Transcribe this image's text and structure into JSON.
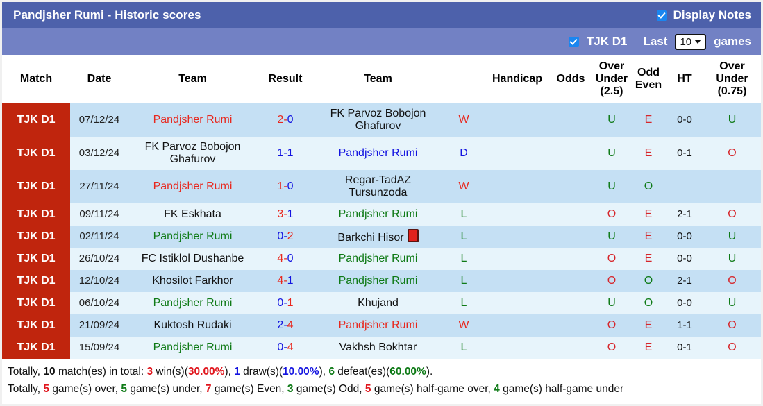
{
  "header": {
    "title": "Pandjsher Rumi - Historic scores",
    "display_notes_label": "Display Notes",
    "display_notes_checked": true,
    "league_label": "TJK D1",
    "league_checked": true,
    "last_label": "Last",
    "games_count": "10",
    "games_label": "games",
    "bar_color": "#4d61ab",
    "filter_bar_color": "#7281c4"
  },
  "table": {
    "columns": [
      "Match",
      "Date",
      "Team",
      "Result",
      "Team",
      "Handicap",
      "Odds",
      "Over Under (2.5)",
      "Odd Even",
      "HT",
      "Over Under (0.75)"
    ],
    "headers": {
      "match": "Match",
      "date": "Date",
      "team_home": "Team",
      "result": "Result",
      "team_away": "Team",
      "wdl": "",
      "handicap": "Handicap",
      "odds": "Odds",
      "ou25_l1": "Over",
      "ou25_l2": "Under",
      "ou25_l3": "(2.5)",
      "oe_l1": "Odd",
      "oe_l2": "Even",
      "ht": "HT",
      "ou075_l1": "Over",
      "ou075_l2": "Under",
      "ou075_l3": "(0.75)"
    },
    "rows": [
      {
        "match": "TJK D1",
        "date": "07/12/24",
        "home": "Pandjsher Rumi",
        "home_color": "red",
        "score_home": "2",
        "score_away": "0",
        "score_home_color": "red",
        "score_away_color": "blue",
        "away": "FK Parvoz Bobojon Ghafurov",
        "away_color": "black",
        "away_redcard": false,
        "wdl": "W",
        "wdl_color": "red",
        "handicap": "",
        "odds": "",
        "ou25": "U",
        "ou25_color": "green",
        "oe": "E",
        "oe_color": "red",
        "ht": "0-0",
        "ou075": "U",
        "ou075_color": "green",
        "tall": true
      },
      {
        "match": "TJK D1",
        "date": "03/12/24",
        "home": "FK Parvoz Bobojon Ghafurov",
        "home_color": "black",
        "score_home": "1",
        "score_away": "1",
        "score_home_color": "blue",
        "score_away_color": "blue",
        "away": "Pandjsher Rumi",
        "away_color": "blue",
        "away_redcard": false,
        "wdl": "D",
        "wdl_color": "blue",
        "handicap": "",
        "odds": "",
        "ou25": "U",
        "ou25_color": "green",
        "oe": "E",
        "oe_color": "red",
        "ht": "0-1",
        "ou075": "O",
        "ou075_color": "red",
        "tall": true
      },
      {
        "match": "TJK D1",
        "date": "27/11/24",
        "home": "Pandjsher Rumi",
        "home_color": "red",
        "score_home": "1",
        "score_away": "0",
        "score_home_color": "red",
        "score_away_color": "blue",
        "away": "Regar-TadAZ Tursunzoda",
        "away_color": "black",
        "away_redcard": false,
        "wdl": "W",
        "wdl_color": "red",
        "handicap": "",
        "odds": "",
        "ou25": "U",
        "ou25_color": "green",
        "oe": "O",
        "oe_color": "green",
        "ht": "",
        "ou075": "",
        "ou075_color": "green",
        "tall": true
      },
      {
        "match": "TJK D1",
        "date": "09/11/24",
        "home": "FK Eskhata",
        "home_color": "black",
        "score_home": "3",
        "score_away": "1",
        "score_home_color": "red",
        "score_away_color": "blue",
        "away": "Pandjsher Rumi",
        "away_color": "green",
        "away_redcard": false,
        "wdl": "L",
        "wdl_color": "green",
        "handicap": "",
        "odds": "",
        "ou25": "O",
        "ou25_color": "red",
        "oe": "E",
        "oe_color": "red",
        "ht": "2-1",
        "ou075": "O",
        "ou075_color": "red",
        "tall": false
      },
      {
        "match": "TJK D1",
        "date": "02/11/24",
        "home": "Pandjsher Rumi",
        "home_color": "green",
        "score_home": "0",
        "score_away": "2",
        "score_home_color": "blue",
        "score_away_color": "red",
        "away": "Barkchi Hisor",
        "away_color": "black",
        "away_redcard": true,
        "wdl": "L",
        "wdl_color": "green",
        "handicap": "",
        "odds": "",
        "ou25": "U",
        "ou25_color": "green",
        "oe": "E",
        "oe_color": "red",
        "ht": "0-0",
        "ou075": "U",
        "ou075_color": "green",
        "tall": false
      },
      {
        "match": "TJK D1",
        "date": "26/10/24",
        "home": "FC Istiklol Dushanbe",
        "home_color": "black",
        "score_home": "4",
        "score_away": "0",
        "score_home_color": "red",
        "score_away_color": "blue",
        "away": "Pandjsher Rumi",
        "away_color": "green",
        "away_redcard": false,
        "wdl": "L",
        "wdl_color": "green",
        "handicap": "",
        "odds": "",
        "ou25": "O",
        "ou25_color": "red",
        "oe": "E",
        "oe_color": "red",
        "ht": "0-0",
        "ou075": "U",
        "ou075_color": "green",
        "tall": false
      },
      {
        "match": "TJK D1",
        "date": "12/10/24",
        "home": "Khosilot Farkhor",
        "home_color": "black",
        "score_home": "4",
        "score_away": "1",
        "score_home_color": "red",
        "score_away_color": "blue",
        "away": "Pandjsher Rumi",
        "away_color": "green",
        "away_redcard": false,
        "wdl": "L",
        "wdl_color": "green",
        "handicap": "",
        "odds": "",
        "ou25": "O",
        "ou25_color": "red",
        "oe": "O",
        "oe_color": "green",
        "ht": "2-1",
        "ou075": "O",
        "ou075_color": "red",
        "tall": false
      },
      {
        "match": "TJK D1",
        "date": "06/10/24",
        "home": "Pandjsher Rumi",
        "home_color": "green",
        "score_home": "0",
        "score_away": "1",
        "score_home_color": "blue",
        "score_away_color": "red",
        "away": "Khujand",
        "away_color": "black",
        "away_redcard": false,
        "wdl": "L",
        "wdl_color": "green",
        "handicap": "",
        "odds": "",
        "ou25": "U",
        "ou25_color": "green",
        "oe": "O",
        "oe_color": "green",
        "ht": "0-0",
        "ou075": "U",
        "ou075_color": "green",
        "tall": false
      },
      {
        "match": "TJK D1",
        "date": "21/09/24",
        "home": "Kuktosh Rudaki",
        "home_color": "black",
        "score_home": "2",
        "score_away": "4",
        "score_home_color": "blue",
        "score_away_color": "red",
        "away": "Pandjsher Rumi",
        "away_color": "red",
        "away_redcard": false,
        "wdl": "W",
        "wdl_color": "red",
        "handicap": "",
        "odds": "",
        "ou25": "O",
        "ou25_color": "red",
        "oe": "E",
        "oe_color": "red",
        "ht": "1-1",
        "ou075": "O",
        "ou075_color": "red",
        "tall": false
      },
      {
        "match": "TJK D1",
        "date": "15/09/24",
        "home": "Pandjsher Rumi",
        "home_color": "green",
        "score_home": "0",
        "score_away": "4",
        "score_home_color": "blue",
        "score_away_color": "red",
        "away": "Vakhsh Bokhtar",
        "away_color": "black",
        "away_redcard": false,
        "wdl": "L",
        "wdl_color": "green",
        "handicap": "",
        "odds": "",
        "ou25": "O",
        "ou25_color": "red",
        "oe": "E",
        "oe_color": "red",
        "ht": "0-1",
        "ou075": "O",
        "ou075_color": "red",
        "tall": false
      }
    ]
  },
  "summary": {
    "line1": {
      "prefix": "Totally, ",
      "total": "10",
      "t1": " match(es) in total: ",
      "wins": "3",
      "t2": " win(s)(",
      "win_pct": "30.00%",
      "t3": "), ",
      "draws": "1",
      "t4": " draw(s)(",
      "draw_pct": "10.00%",
      "t5": "), ",
      "defeats": "6",
      "t6": " defeat(es)(",
      "defeat_pct": "60.00%",
      "t7": ")."
    },
    "line2": {
      "prefix": "Totally, ",
      "over": "5",
      "t1": " game(s) over, ",
      "under": "5",
      "t2": " game(s) under, ",
      "even": "7",
      "t3": " game(s) Even, ",
      "odd": "3",
      "t4": " game(s) Odd, ",
      "half_over": "5",
      "t5": " game(s) half-game over, ",
      "half_under": "4",
      "t6": " game(s) half-game under"
    }
  }
}
